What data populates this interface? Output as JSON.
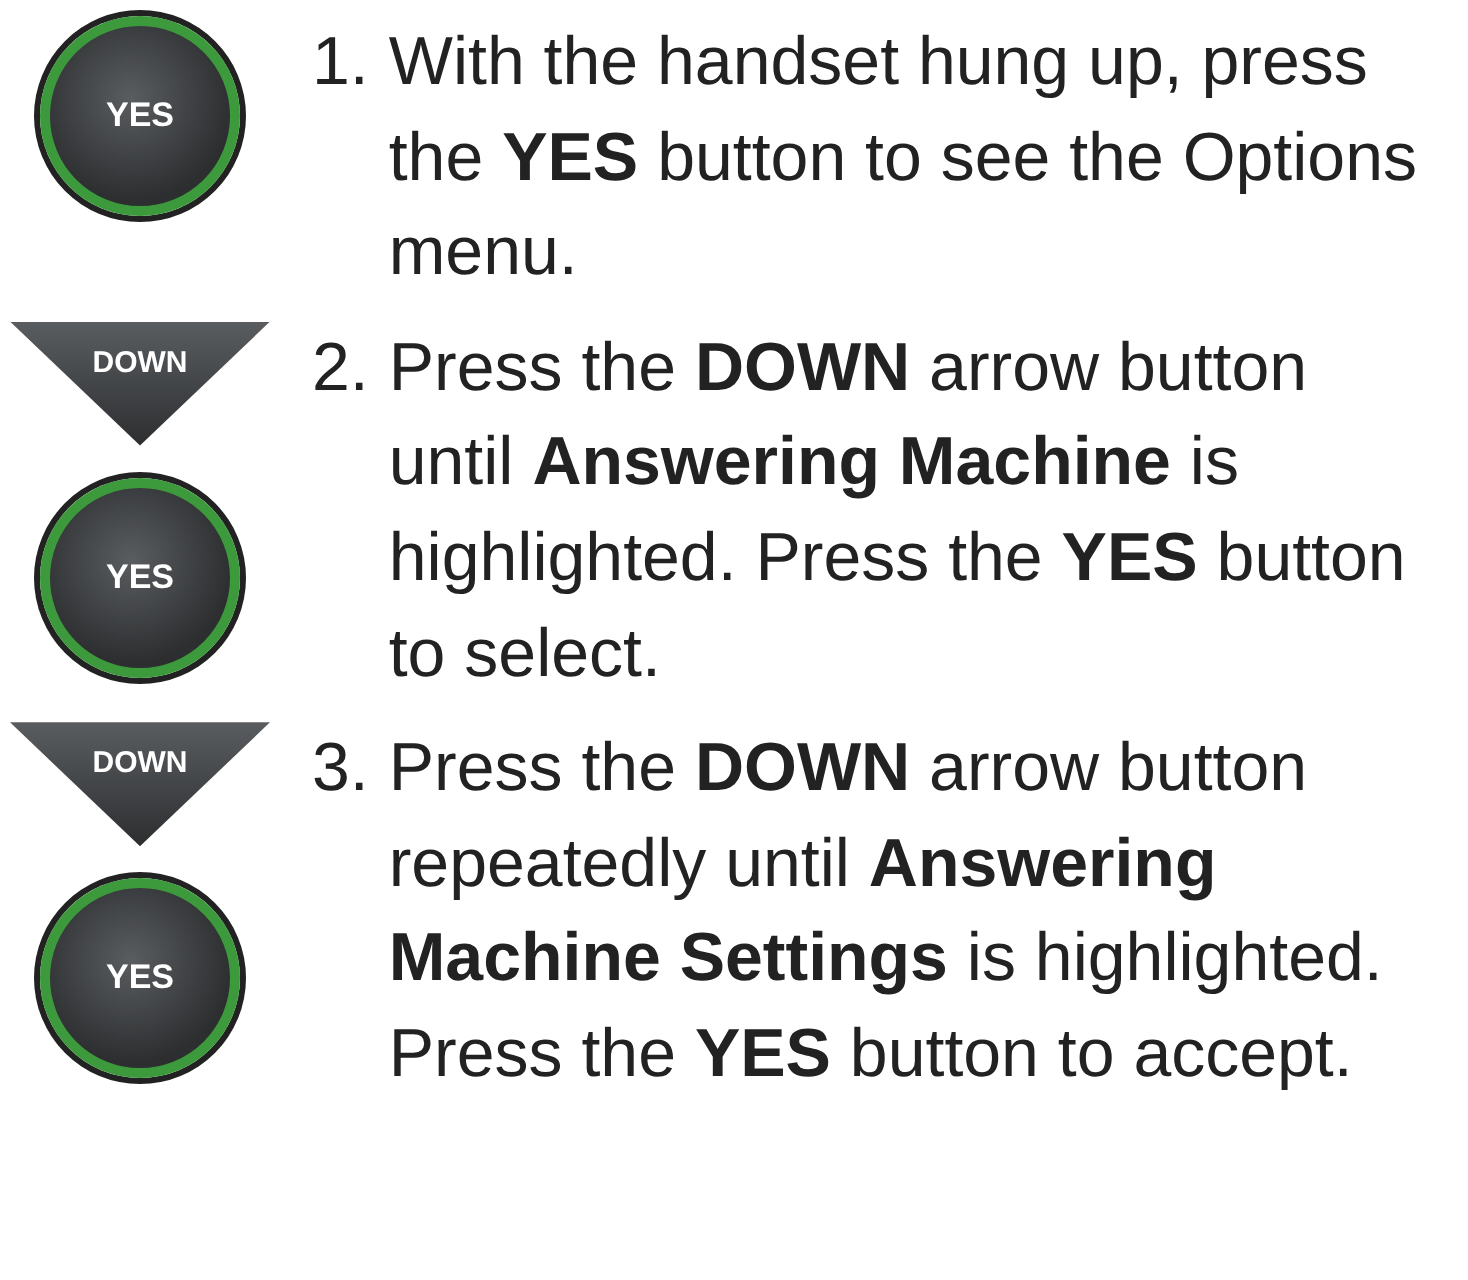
{
  "steps": [
    {
      "number": "1.",
      "text": "With the handset hung up, press the **YES** button to see the Options menu.",
      "keys": [
        {
          "kind": "yes",
          "label": "YES"
        }
      ]
    },
    {
      "number": "2.",
      "text": "Press the **DOWN** arrow button until **Answering Machine** is highlighted. Press the **YES** button to select.",
      "keys": [
        {
          "kind": "down",
          "label": "DOWN"
        },
        {
          "kind": "yes",
          "label": "YES"
        }
      ]
    },
    {
      "number": "3.",
      "text": "Press the **DOWN** arrow button repeatedly until **Answering Machine Settings** is highlighted. Press the **YES** button to accept.",
      "keys": [
        {
          "kind": "down",
          "label": "DOWN"
        },
        {
          "kind": "yes",
          "label": "YES"
        }
      ]
    }
  ]
}
